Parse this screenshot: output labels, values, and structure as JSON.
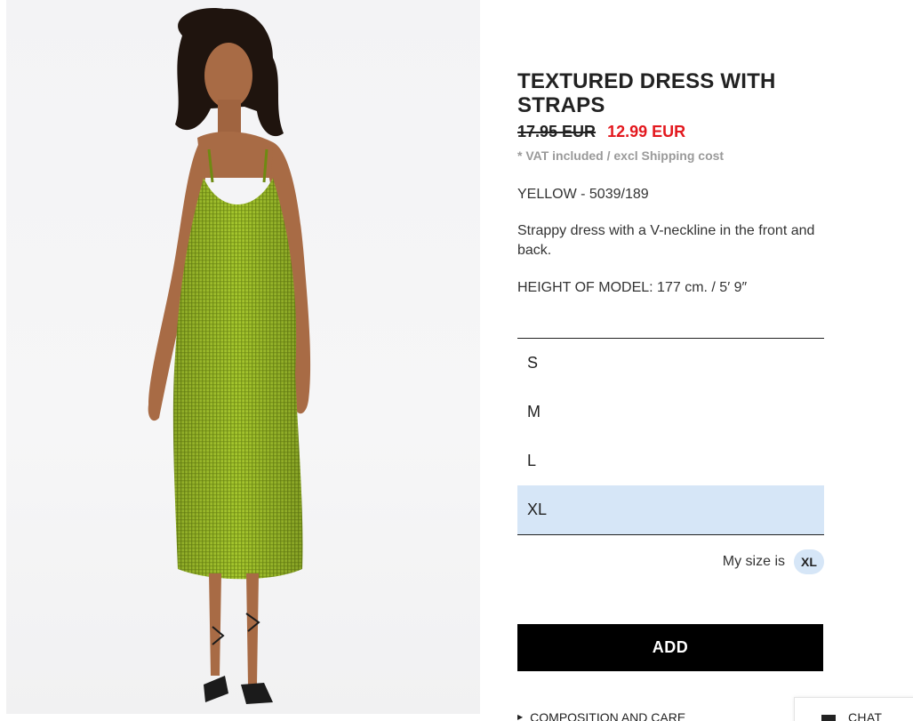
{
  "product": {
    "title": "TEXTURED DRESS WITH STRAPS",
    "old_price": "17.95 EUR",
    "sale_price": "12.99 EUR",
    "vat_note": "* VAT included / excl Shipping cost",
    "color_ref": "YELLOW - 5039/189",
    "description": "Strappy dress with a V-neckline in the front and back.",
    "model_height": "HEIGHT OF MODEL: 177 cm. / 5′ 9″"
  },
  "sizes": [
    {
      "label": "S",
      "selected": false
    },
    {
      "label": "M",
      "selected": false
    },
    {
      "label": "L",
      "selected": false
    },
    {
      "label": "XL",
      "selected": true
    }
  ],
  "my_size": {
    "label": "My size is",
    "value": "XL"
  },
  "actions": {
    "add_label": "ADD",
    "composition_label": "COMPOSITION AND CARE"
  },
  "chat": {
    "label": "CHAT"
  },
  "colors": {
    "sale_price": "#e3181e",
    "selected_size_bg": "#d6e6f7",
    "add_button_bg": "#000000",
    "dress": "#a4c62c"
  },
  "icons": {
    "composition_caret": "caret-right-icon",
    "chat": "chat-square-icon"
  }
}
